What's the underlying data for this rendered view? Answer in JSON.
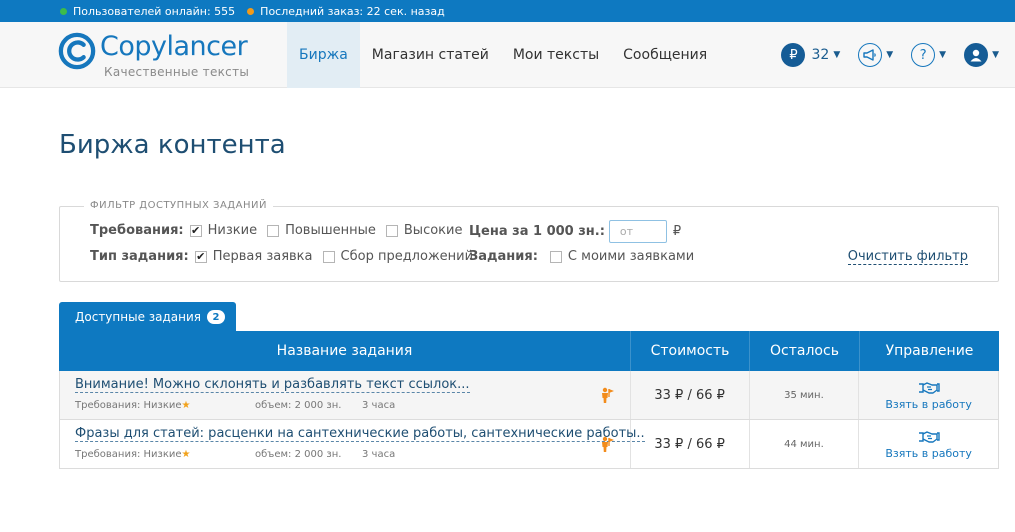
{
  "status_bar": {
    "online_users": "Пользователей онлайн: 555",
    "last_order": "Последний заказ: 22 сек. назад",
    "online_dot_color": "#3dbb4a",
    "order_dot_color": "#f29a1a"
  },
  "header": {
    "logo_name": "Copylancer",
    "logo_sub": "Качественные тексты",
    "nav": [
      {
        "label": "Биржа",
        "active": true
      },
      {
        "label": "Магазин статей",
        "active": false
      },
      {
        "label": "Мои тексты",
        "active": false
      },
      {
        "label": "Сообщения",
        "active": false
      }
    ],
    "balance_symbol": "₽",
    "balance_value": "32",
    "icons": [
      "ruble-icon",
      "megaphone-icon",
      "help-icon",
      "user-icon"
    ]
  },
  "page": {
    "title": "Биржа контента"
  },
  "filter": {
    "legend": "ФИЛЬТР ДОСТУПНЫХ ЗАДАНИЙ",
    "requirements_label": "Требования:",
    "requirements": [
      {
        "label": "Низкие",
        "checked": true
      },
      {
        "label": "Повышенные",
        "checked": false
      },
      {
        "label": "Высокие",
        "checked": false
      }
    ],
    "task_type_label": "Тип задания:",
    "task_types": [
      {
        "label": "Первая заявка",
        "checked": true
      },
      {
        "label": "Сбор предложений",
        "checked": false
      }
    ],
    "price_label": "Цена за 1 000 зн.:",
    "price_placeholder": "от",
    "price_currency": "₽",
    "tasks_label": "Задания:",
    "my_requests": {
      "label": "С моими заявками",
      "checked": false
    },
    "clear_label": "Очистить фильтр"
  },
  "tab": {
    "label": "Доступные задания",
    "count": "2"
  },
  "table": {
    "headers": [
      "Название задания",
      "Стоимость",
      "Осталось",
      "Управление"
    ],
    "rows": [
      {
        "title": "Внимание! Можно склонять и разбавлять текст ссылок...",
        "requirements": "Требования: Низкие",
        "volume": "объем: 2 000 зн.",
        "time": "3 часа",
        "cost": "33 ₽ / 66 ₽",
        "left": "35 мин.",
        "action": "Взять в работу"
      },
      {
        "title": "Фразы для статей: расценки на сантехнические работы, сантехнические работы..",
        "requirements": "Требования: Низкие",
        "volume": "объем: 2 000 зн.",
        "time": "3 часа",
        "cost": "33 ₽ / 66 ₽",
        "left": "44 мин.",
        "action": "Взять в работу"
      }
    ]
  }
}
